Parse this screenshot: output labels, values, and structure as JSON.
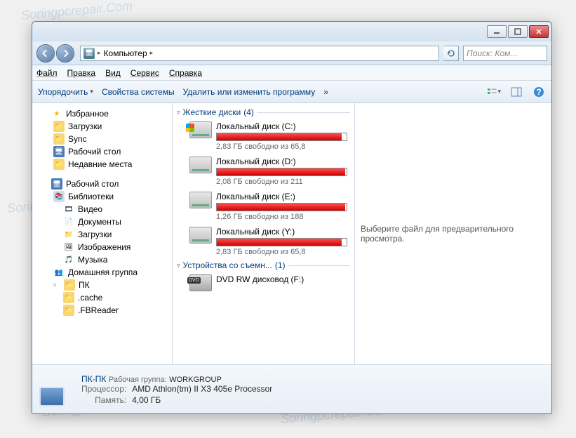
{
  "address": {
    "location": "Компьютер"
  },
  "search": {
    "placeholder": "Поиск: Ком..."
  },
  "menu": {
    "file": "Файл",
    "edit": "Правка",
    "view": "Вид",
    "tools": "Сервис",
    "help": "Справка"
  },
  "toolbar": {
    "organize": "Упорядочить",
    "properties": "Свойства системы",
    "uninstall": "Удалить или изменить программу",
    "more": "»"
  },
  "nav": {
    "favorites": "Избранное",
    "downloads": "Загрузки",
    "sync": "Sync",
    "desktop_fav": "Рабочий стол",
    "recent": "Недавние места",
    "desktop": "Рабочий стол",
    "libraries": "Библиотеки",
    "videos": "Видео",
    "documents": "Документы",
    "downloads2": "Загрузки",
    "pictures": "Изображения",
    "music": "Музыка",
    "homegroup": "Домашняя группа",
    "pc": "ПК",
    "cache": ".cache",
    "fbreader": ".FBReader"
  },
  "groups": {
    "hdd": {
      "label": "Жесткие диски",
      "count": "(4)"
    },
    "removable": {
      "label": "Устройства со съемн...",
      "count": "(1)"
    }
  },
  "drives": [
    {
      "name": "Локальный диск (C:)",
      "free": "2,83 ГБ свободно из 65,8",
      "fill": 96,
      "windows": true
    },
    {
      "name": "Локальный диск (D:)",
      "free": "2,08 ГБ свободно из 211",
      "fill": 99,
      "windows": false
    },
    {
      "name": "Локальный диск (E:)",
      "free": "1,26 ГБ свободно из 188",
      "fill": 99,
      "windows": false
    },
    {
      "name": "Локальный диск (Y:)",
      "free": "2,83 ГБ свободно из 65,8",
      "fill": 96,
      "windows": false
    }
  ],
  "dvd": {
    "name": "DVD RW дисковод (F:)"
  },
  "preview": {
    "text": "Выберите файл для предварительного просмотра."
  },
  "details": {
    "name": "ПК-ПК",
    "workgroup_lbl": "Рабочая группа:",
    "workgroup": "WORKGROUP",
    "cpu_lbl": "Процессор:",
    "cpu": "AMD Athlon(tm) II X3 405e Processor",
    "mem_lbl": "Память:",
    "mem": "4,00 ГБ"
  },
  "watermark": "Soringpcrepair.Com"
}
